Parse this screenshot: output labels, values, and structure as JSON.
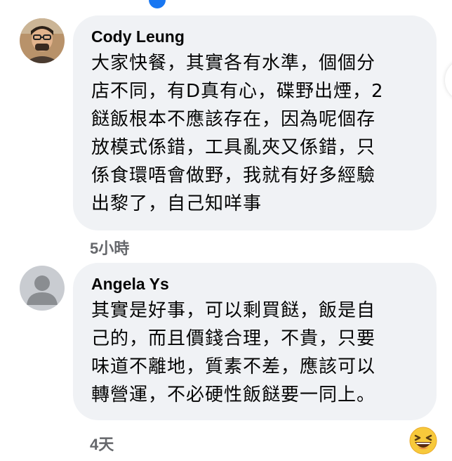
{
  "comments": [
    {
      "author": "Cody Leung",
      "lines": [
        "大家快餐，其實各有水準，個個分",
        "店不同，有D真有心，碟野出煙，2",
        "餸飯根本不應該存在，因為呢個存",
        "放模式係錯，工具亂夾又係錯，只",
        "係食環唔會做野，我就有好多經驗",
        "出黎了，自己知咩事"
      ],
      "time": "5小時"
    },
    {
      "author": "Angela Ys",
      "lines": [
        "其實是好事，可以剩買餸，飯是自",
        "己的，而且價錢合理，不貴，只要",
        "味道不離地，質素不差，應該可以",
        "轉營運，不必硬性飯餸要一同上。"
      ],
      "time": "4天"
    }
  ],
  "reaction": {
    "icon": "laughing-emoji-icon"
  },
  "colors": {
    "bubble_bg": "#f0f2f5",
    "meta_text": "#65676b",
    "main_text": "#050505"
  }
}
